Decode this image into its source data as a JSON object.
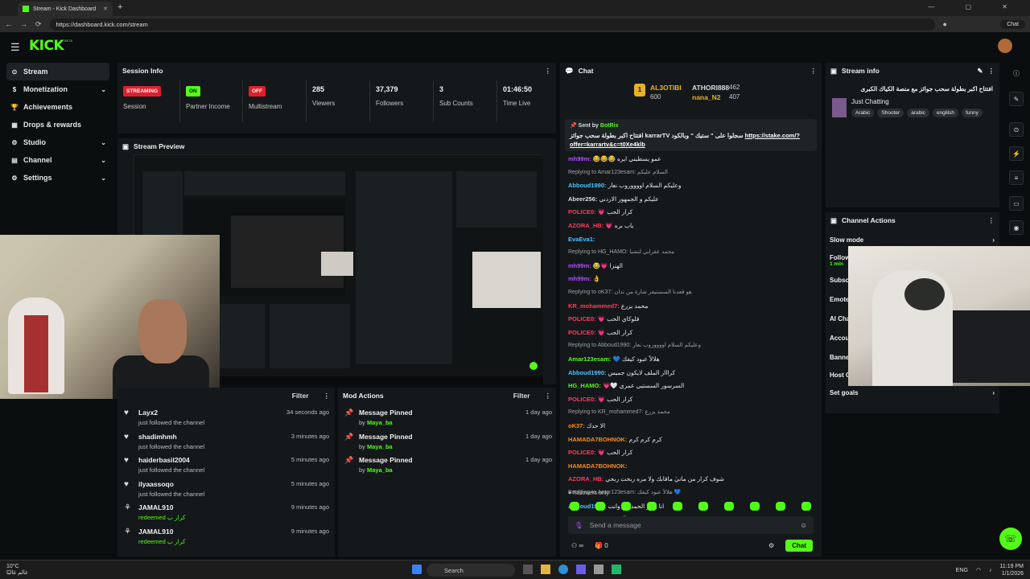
{
  "browser": {
    "tab_title": "Stream - Kick Dashboard",
    "new_tab": "+",
    "url": "https://dashboard.kick.com/stream",
    "chat_button": "Chat",
    "window_controls": "— ▢ ✕"
  },
  "topnav": {
    "logo": "KICK",
    "logo_sup": "BETA"
  },
  "sidebar": {
    "items": [
      {
        "label": "Stream",
        "icon": "stream-icon",
        "active": true,
        "chevron": false
      },
      {
        "label": "Monetization",
        "icon": "dollar-icon",
        "chevron": true
      },
      {
        "label": "Achievements",
        "icon": "trophy-icon",
        "chevron": false
      },
      {
        "label": "Drops & rewards",
        "icon": "gift-icon",
        "chevron": false
      },
      {
        "label": "Studio",
        "icon": "studio-icon",
        "chevron": true
      },
      {
        "label": "Channel",
        "icon": "channel-icon",
        "chevron": true
      },
      {
        "label": "Settings",
        "icon": "gear-icon",
        "chevron": true
      }
    ]
  },
  "session": {
    "title": "Session Info",
    "stats": [
      {
        "value": "STREAMING",
        "label": "Session",
        "kind": "badge-red"
      },
      {
        "value": "ON",
        "label": "Partner Income",
        "kind": "badge-green"
      },
      {
        "value": "OFF",
        "label": "Multistream",
        "kind": "badge-red"
      },
      {
        "value": "285",
        "label": "Viewers",
        "kind": "text"
      },
      {
        "value": "37,379",
        "label": "Followers",
        "kind": "text"
      },
      {
        "value": "3",
        "label": "Sub Counts",
        "kind": "text"
      },
      {
        "value": "01:46:50",
        "label": "Time Live",
        "kind": "text"
      }
    ]
  },
  "preview": {
    "title": "Stream Preview"
  },
  "followers": {
    "filter": "Filter",
    "rows": [
      {
        "name": "Layx2",
        "sub": "just followed the channel",
        "time": "34 seconds ago",
        "icon": "heart-icon"
      },
      {
        "name": "shadimhmh",
        "sub": "just followed the channel",
        "time": "3 minutes ago",
        "icon": "heart-icon"
      },
      {
        "name": "haiderbasil2004",
        "sub": "just followed the channel",
        "time": "5 minutes ago",
        "icon": "heart-icon"
      },
      {
        "name": "ilyaassoqo",
        "sub": "just followed the channel",
        "time": "5 minutes ago",
        "icon": "heart-icon"
      },
      {
        "name": "JAMAL910",
        "sub": "redeemed كرار ب",
        "time": "9 minutes ago",
        "icon": "reward-icon"
      },
      {
        "name": "JAMAL910",
        "sub": "redeemed كرار ب",
        "time": "9 minutes ago",
        "icon": "reward-icon"
      }
    ]
  },
  "mod_actions": {
    "title": "Mod Actions",
    "filter": "Filter",
    "rows": [
      {
        "name": "Message Pinned",
        "by_prefix": "by",
        "by": "Maya_ba",
        "time": "1 day ago"
      },
      {
        "name": "Message Pinned",
        "by_prefix": "by",
        "by": "Maya_ba",
        "time": "1 day ago"
      },
      {
        "name": "Message Pinned",
        "by_prefix": "by",
        "by": "Maya_ba",
        "time": "1 day ago"
      }
    ]
  },
  "chat": {
    "title": "Chat",
    "gifters": [
      {
        "rank": "1",
        "name": "AL3OTIBI",
        "amount": "600"
      },
      {
        "name": "ATHORI888",
        "amount": "462"
      },
      {
        "name": "nana_N2",
        "amount": "407"
      }
    ],
    "pinned": {
      "sent_by_prefix": "Sent by",
      "sent_by": "BotRix",
      "message": "افتتاح اكبر بطولة سحب جوائز karrarTV سجلوا على \" ستيك \" وبالكود",
      "link": "https://stake.com/?offer=karrartv&c=t0Xe4klb"
    },
    "messages": [
      {
        "user": "mh99m:",
        "color": "#b04cff",
        "text": "😂😂😂 عمو يسطيني ايره"
      },
      {
        "reply": "Replying to Amar123esam: السلام عليكم"
      },
      {
        "user": "Abboud1990:",
        "color": "#4cc3ff",
        "text": "وعليكم السلام اووووروب نعار"
      },
      {
        "user": "Abeer256:",
        "color": "#dddddd",
        "text": "عليكم و الجمهور الاردني"
      },
      {
        "user": "POLICE0:",
        "color": "#ff3b5c",
        "text": "💗 كرار الحب"
      },
      {
        "user": "AZORA_HB:",
        "color": "#ff3b5c",
        "text": "💗 ياب بره"
      },
      {
        "user": "EvaEva1:",
        "color": "#4cc3ff",
        "text": ""
      },
      {
        "reply": "Replying to HG_HAMO: محمد عقرابي لتشيا"
      },
      {
        "user": "mh99m:",
        "color": "#b04cff",
        "text": "😂💗 الهنزا"
      },
      {
        "user": "mh99m:",
        "color": "#b04cff",
        "text": "👌"
      },
      {
        "reply": "Replying to oK37: هو قعدنا السستيفر شارة من تدان"
      },
      {
        "user": "KR_mohammed7:",
        "color": "#ff3b5c",
        "text": "محمد يزرع"
      },
      {
        "user": "POLICE0:",
        "color": "#ff3b5c",
        "text": "💗 قلوكاي الحب"
      },
      {
        "user": "POLICE0:",
        "color": "#ff3b5c",
        "text": "💗 كرار الحب"
      },
      {
        "reply": "Replying to Abboud1990: وعليكم السلام اووووروب نعار"
      },
      {
        "user": "Amar123esam:",
        "color": "#53fc18",
        "text": "💙 هلالاً عبود كيفك"
      },
      {
        "user": "Abboud1990:",
        "color": "#4cc3ff",
        "text": "كرااار الملف لايكون جميس"
      },
      {
        "user": "HG_HAMO:",
        "color": "#53fc18",
        "text": "💗🤍 السرسور السستيي عمري"
      },
      {
        "user": "POLICE0:",
        "color": "#ff3b5c",
        "text": "💗 كرار الحب"
      },
      {
        "reply": "Replying to KR_mohammed7: محمد يزرع"
      },
      {
        "user": "oK37:",
        "color": "#ff8c1a",
        "text": "الا حدك"
      },
      {
        "user": "HAMADA7BOHNOK:",
        "color": "#ff8c1a",
        "text": "كرم   كرم   كرم"
      },
      {
        "user": "POLICE0:",
        "color": "#ff3b5c",
        "text": "💗 كرار الحب"
      },
      {
        "user": "HAMADA7BOHNOK:",
        "color": "#ff8c1a",
        "text": ""
      },
      {
        "user": "AZORA_HB:",
        "color": "#ff3b5c",
        "text": "شوف كرار من مانيٰ ماقابك ولا مره ربحت ربحي"
      },
      {
        "reply": "Replying to Amar123esam: هلالاً عبود كيفك 💙"
      },
      {
        "user": "Abboud1990:",
        "color": "#4cc3ff",
        "text": "انا بخير الحمد لله وانت"
      },
      {
        "user": "KR_mohammed7:",
        "color": "#ff3b5c",
        "text": "😘 فادس من اليمن"
      }
    ],
    "followers_only": "Followers only",
    "placeholder": "Send a message",
    "footer_count_a": "∞",
    "footer_count_b": "0",
    "send": "Chat"
  },
  "stream_info": {
    "title": "Stream info",
    "stream_title": "افتتاح اكبر بطولة سحب جوائز مع منصة الكياك الكبرى",
    "category": "Just Chatting",
    "tags": [
      "Arabic",
      "Shooter",
      "arabic",
      "englilsh",
      "funny"
    ]
  },
  "channel_actions": {
    "title": "Channel Actions",
    "items": [
      {
        "label": "Slow mode",
        "sub": "",
        "chevron": true
      },
      {
        "label": "Follow",
        "sub": "1 min",
        "chevron": false
      },
      {
        "label": "Subsc",
        "sub": "",
        "chevron": false
      },
      {
        "label": "Emote",
        "sub": "",
        "chevron": false
      },
      {
        "label": "AI Cha",
        "sub": "",
        "chevron": false
      },
      {
        "label": "Accou",
        "sub": "",
        "chevron": false
      },
      {
        "label": "Banne",
        "sub": "",
        "chevron": false
      },
      {
        "label": "Host C",
        "sub": "",
        "chevron": false
      },
      {
        "label": "Set goals",
        "sub": "",
        "chevron": true
      }
    ]
  },
  "taskbar": {
    "weather_temp": "10°C",
    "weather_text": "عالم غالبًا",
    "search": "Search",
    "lang": "ENG",
    "time": "11:19 PM",
    "date": "1/1/2026"
  },
  "colors": {
    "accent": "#53fc18",
    "live_red": "#e01f2d",
    "panel": "#14181a",
    "bg": "#0b0e0f"
  }
}
